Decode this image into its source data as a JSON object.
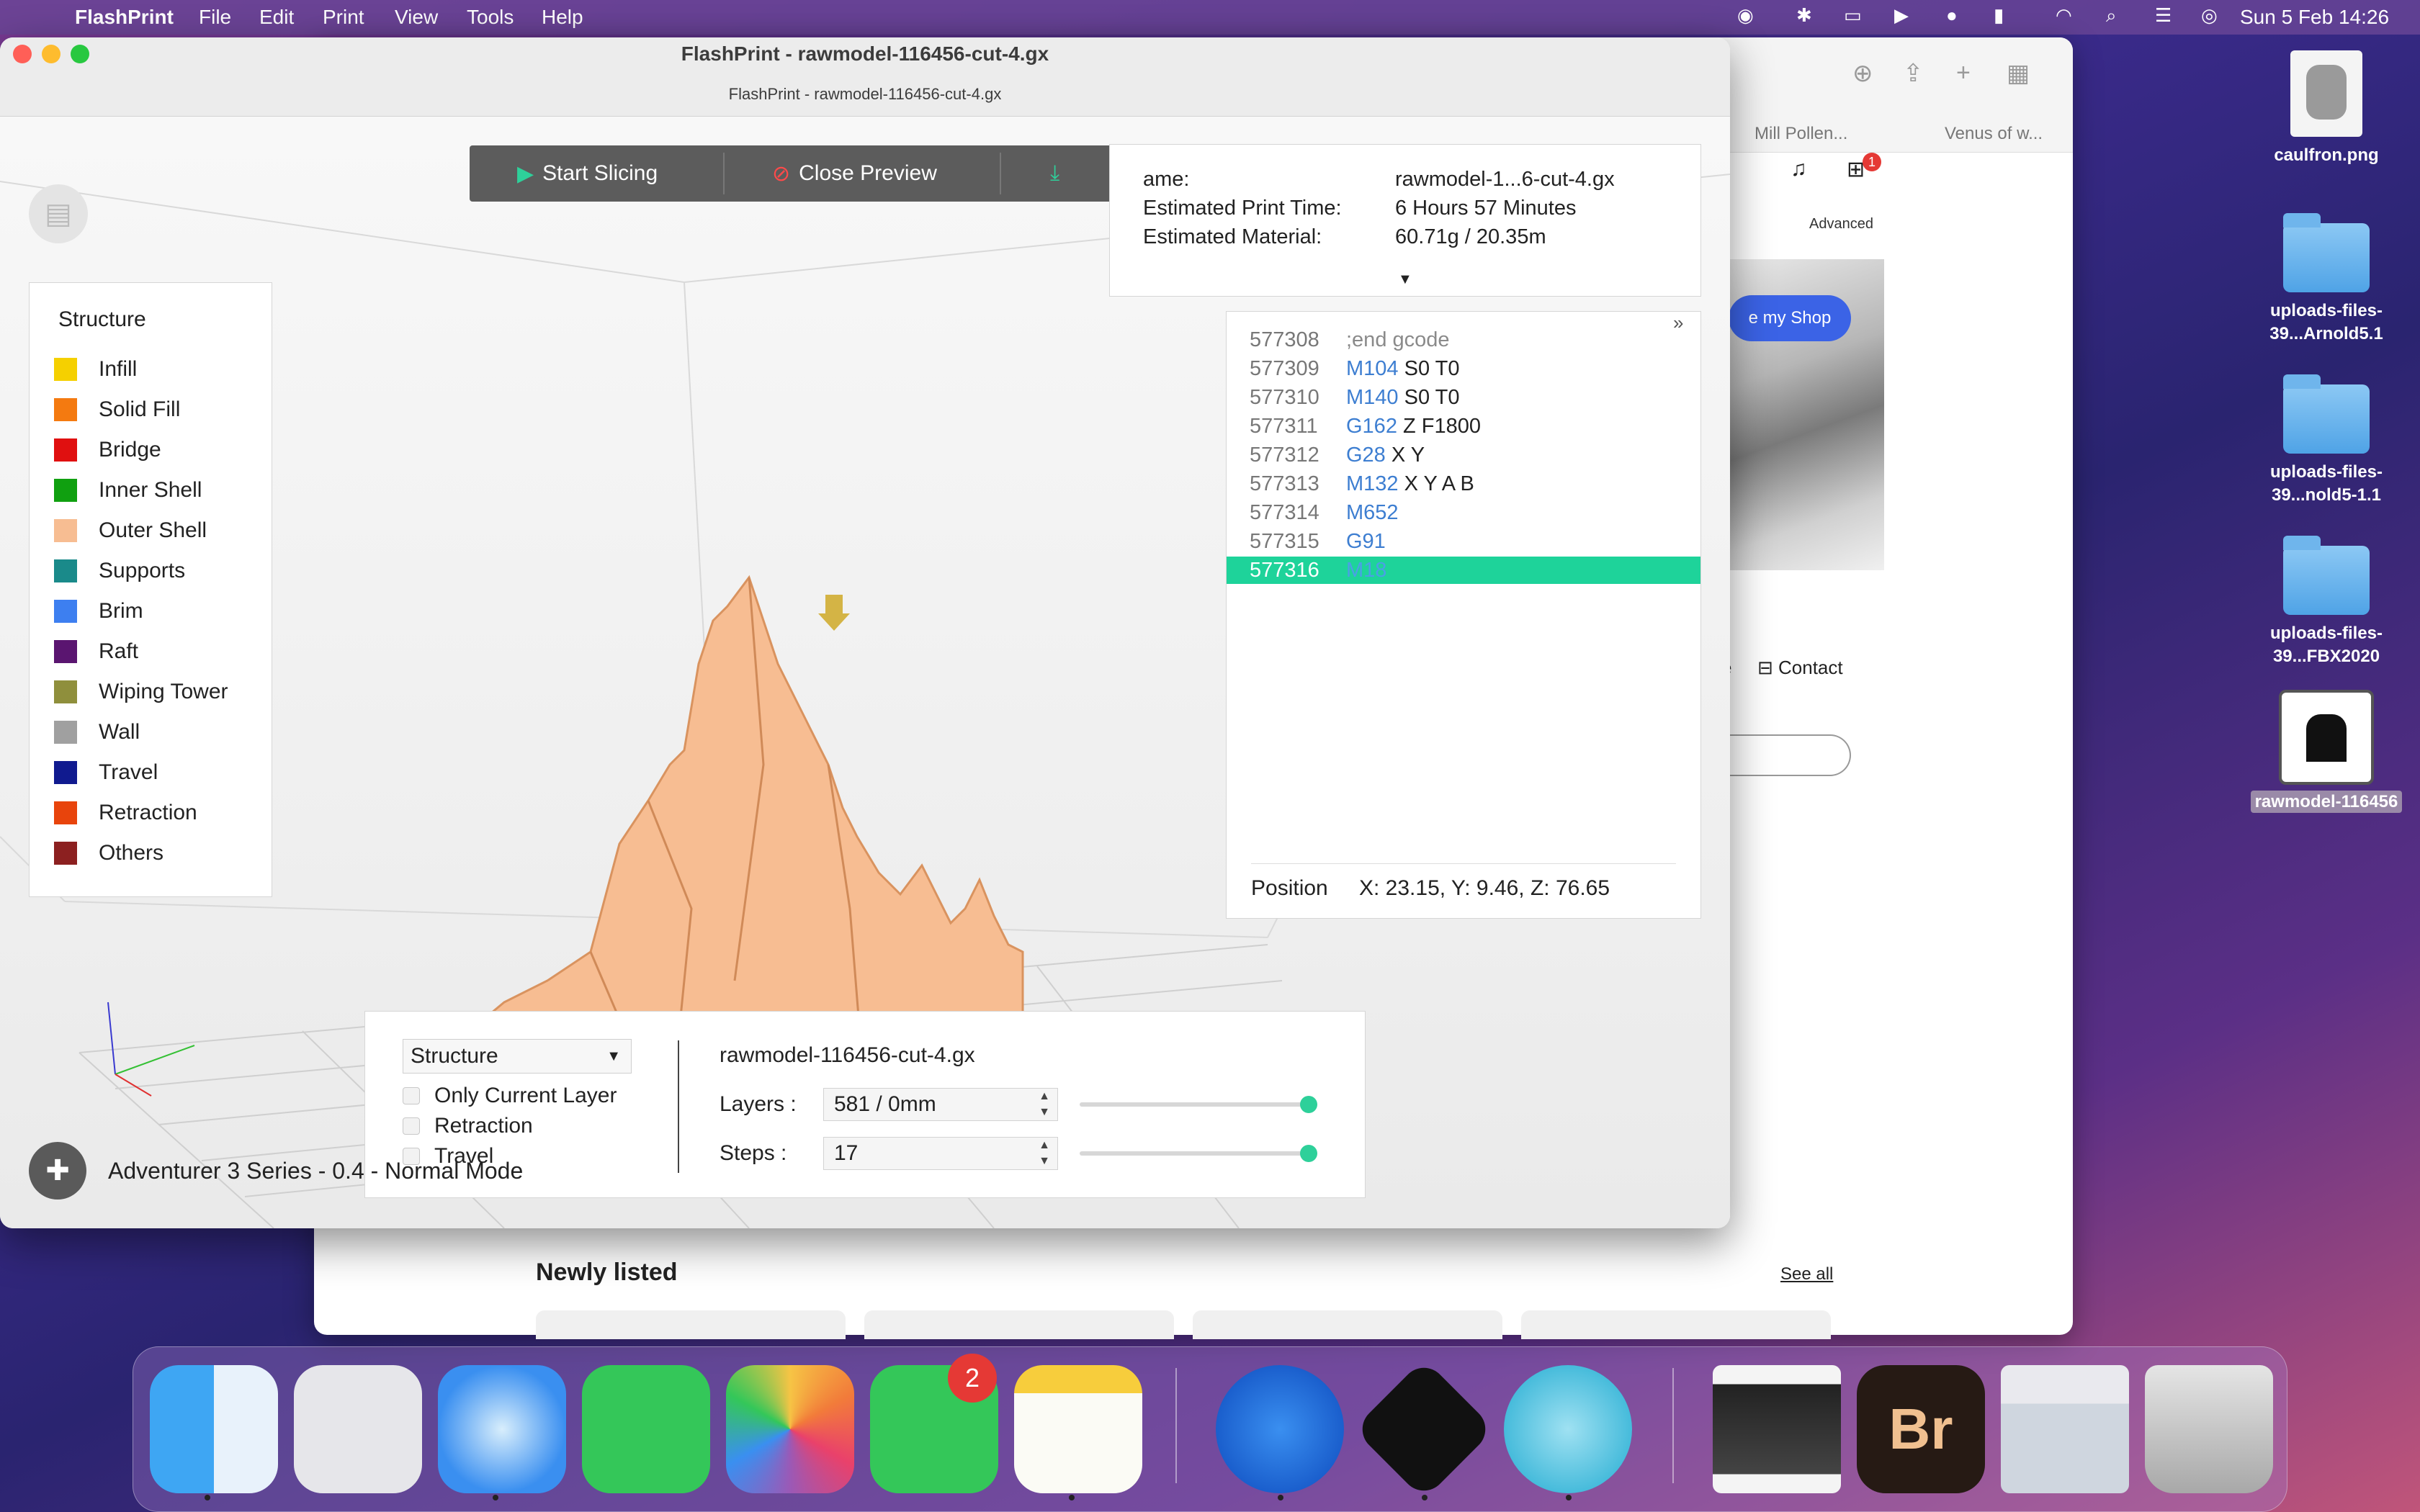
{
  "menubar": {
    "app": "FlashPrint",
    "items": [
      "File",
      "Edit",
      "Print",
      "View",
      "Tools",
      "Help"
    ],
    "clock": "Sun 5 Feb  14:26"
  },
  "window": {
    "title": "FlashPrint - rawmodel-116456-cut-4.gx",
    "subtitle": "FlashPrint - rawmodel-116456-cut-4.gx"
  },
  "toolbar": {
    "start_slicing": "Start Slicing",
    "close_preview": "Close Preview"
  },
  "print_info": {
    "name_label": "ame:",
    "name_value": "rawmodel-1...6-cut-4.gx",
    "time_label": "Estimated Print Time:",
    "time_value": "6 Hours 57 Minutes",
    "material_label": "Estimated Material:",
    "material_value": "60.71g / 20.35m"
  },
  "legend": {
    "title": "Structure",
    "items": [
      {
        "label": "Infill",
        "color": "#f5d000"
      },
      {
        "label": "Solid Fill",
        "color": "#f47a10"
      },
      {
        "label": "Bridge",
        "color": "#e01010"
      },
      {
        "label": "Inner Shell",
        "color": "#10a010"
      },
      {
        "label": "Outer Shell",
        "color": "#f7bd92"
      },
      {
        "label": "Supports",
        "color": "#1a8a8a"
      },
      {
        "label": "Brim",
        "color": "#3d7ff0"
      },
      {
        "label": "Raft",
        "color": "#5a1570"
      },
      {
        "label": "Wiping Tower",
        "color": "#8f8f3c"
      },
      {
        "label": "Wall",
        "color": "#a0a0a0"
      },
      {
        "label": "Travel",
        "color": "#101a8f"
      },
      {
        "label": "Retraction",
        "color": "#e8440c"
      },
      {
        "label": "Others",
        "color": "#8c2020"
      }
    ]
  },
  "gcode": {
    "lines": [
      {
        "num": "577308",
        "cmd": "",
        "args": ";end gcode",
        "comment": true
      },
      {
        "num": "577309",
        "cmd": "M104",
        "args": "S0 T0"
      },
      {
        "num": "577310",
        "cmd": "M140",
        "args": "S0 T0"
      },
      {
        "num": "577311",
        "cmd": "G162",
        "args": "Z F1800"
      },
      {
        "num": "577312",
        "cmd": "G28",
        "args": "X Y"
      },
      {
        "num": "577313",
        "cmd": "M132",
        "args": "X Y A B"
      },
      {
        "num": "577314",
        "cmd": "M652",
        "args": ""
      },
      {
        "num": "577315",
        "cmd": "G91",
        "args": ""
      },
      {
        "num": "577316",
        "cmd": "M18",
        "args": ""
      }
    ],
    "position_label": "Position",
    "position_value": "X: 23.15, Y: 9.46, Z: 76.65"
  },
  "controls": {
    "view_mode": "Structure",
    "only_current_layer": "Only Current Layer",
    "retraction": "Retraction",
    "travel": "Travel",
    "file_name": "rawmodel-116456-cut-4.gx",
    "layers_label": "Layers :",
    "layers_value": "581 / 0mm",
    "steps_label": "Steps :",
    "steps_value": "17",
    "layers_slider": 1.0,
    "steps_slider": 1.0
  },
  "machine": {
    "label": "Adventurer 3 Series - 0.4 - Normal Mode"
  },
  "browser": {
    "tab1": "Mill Pollen...",
    "tab2": "Venus of w...",
    "advanced": "Advanced",
    "myshop": "e my Shop",
    "contact": "Contact",
    "newly_listed": "Newly listed",
    "see_all": "See all",
    "cart_badge": "1"
  },
  "desktop": {
    "icons": [
      {
        "label": "caulfron.png"
      },
      {
        "label": "uploads-files-39...Arnold5.1"
      },
      {
        "label": "uploads-files-39...nold5-1.1"
      },
      {
        "label": "uploads-files-39...FBX2020"
      },
      {
        "label": "rawmodel-116456"
      }
    ]
  },
  "dock": {
    "facetime_badge": "2"
  }
}
